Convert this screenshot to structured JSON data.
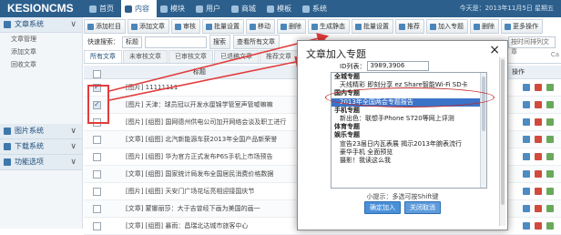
{
  "app": {
    "logo": "KESIONCMS",
    "header_right": "今天是：2013年11月5日 星期五"
  },
  "top_nav": [
    {
      "label": "首页",
      "icon": "home-icon",
      "active": false
    },
    {
      "label": "内容",
      "icon": "document-icon",
      "active": true
    },
    {
      "label": "模块",
      "icon": "grid-icon",
      "active": false
    },
    {
      "label": "用户",
      "icon": "user-icon",
      "active": false
    },
    {
      "label": "商城",
      "icon": "cart-icon",
      "active": false
    },
    {
      "label": "模板",
      "icon": "template-icon",
      "active": false
    },
    {
      "label": "系统",
      "icon": "gear-icon",
      "active": false
    }
  ],
  "sidebar": {
    "groups": [
      {
        "label": "文章系统",
        "icon": "article-icon",
        "items": [
          "文章管理",
          "添加文章",
          "回收文章"
        ]
      },
      {
        "label": "图片系统",
        "icon": "image-icon",
        "items": []
      },
      {
        "label": "下载系统",
        "icon": "download-icon",
        "items": []
      },
      {
        "label": "功能选项",
        "icon": "options-icon",
        "items": []
      }
    ]
  },
  "toolbar": {
    "buttons": [
      "添加栏目",
      "添加文章",
      "审核",
      "批量设置",
      "移动",
      "删除",
      "生成静态",
      "批量设置",
      "推荐",
      "加入专题",
      "删除",
      "更多操作"
    ]
  },
  "filter": {
    "label": "快速搜索：",
    "field": "标题",
    "button": "搜索",
    "advanced": "查看所有文章",
    "right_search": "按时间排列文章"
  },
  "subtabs": [
    "所有文章",
    "未审核文章",
    "已审核文章",
    "已退稿文章",
    "推荐文章",
    "图片文章",
    "滚动文章",
    "头条文章"
  ],
  "right_tab_label": "Ca",
  "table": {
    "header": {
      "title": "标题",
      "right": "操作"
    },
    "rows": [
      {
        "title": "[图片] 11111111",
        "checked": true
      },
      {
        "title": "[图片] 天津：球员冠以开发水厘锦学管室声管嘘嘛嘛",
        "checked": true
      },
      {
        "title": "[图片] [组图] 国网德州供电公司加开网络会谈及职工进行",
        "checked": false
      },
      {
        "title": "[文章] [组图] 北汽新能源车获2013年全国产品新荣誉",
        "checked": false
      },
      {
        "title": "[图片] [组图] 华为官方正式发布P6S手机上市场预告",
        "checked": false
      },
      {
        "title": "[文章] [组图] 国家统计局发布全国居民消费价格数据",
        "checked": false
      },
      {
        "title": "[图片] [组图] 天安门广场花坛亮相迎接国庆节",
        "checked": false
      },
      {
        "title": "[文章] 蒙娜丽莎：大于吉曾经下画为美国的画一",
        "checked": false
      },
      {
        "title": "[文章] [组图] 暴雨：昌瑞北达城市旅客中心",
        "checked": false
      }
    ]
  },
  "modal": {
    "title": "文章加入专题",
    "close": "×",
    "id_label": "ID列表：",
    "id_value": "3989,3906",
    "topics": [
      {
        "label": "全城专题",
        "kind": "group",
        "selected": false
      },
      {
        "label": "天线精彩 即刻分享 ez Share智能Wi-Fi SD卡",
        "kind": "child",
        "selected": false
      },
      {
        "label": "国内专题",
        "kind": "group",
        "selected": false
      },
      {
        "label": "2013年全国两会专题报告",
        "kind": "child",
        "selected": true
      },
      {
        "label": "手机专题",
        "kind": "group",
        "selected": false
      },
      {
        "label": "新出色：联想手Phone S720等网上评测",
        "kind": "child",
        "selected": false
      },
      {
        "label": "体育专题",
        "kind": "group",
        "selected": false
      },
      {
        "label": "娱乐专题",
        "kind": "group",
        "selected": false
      },
      {
        "label": "宣告23届日内瓦表展 揭示2013年腕表流行",
        "kind": "child",
        "selected": false
      },
      {
        "label": "豪华手机 全面预览",
        "kind": "child",
        "selected": false
      },
      {
        "label": "摄影！我读这么我",
        "kind": "child",
        "selected": false
      }
    ],
    "hint": "小提示：多选可按Shift键",
    "confirm": "确定加入",
    "cancel": "关闭取消"
  },
  "colors": {
    "header_bg": "#2c5f8c",
    "selected_item": "#3b73c9",
    "annotation_red": "#e23c3c",
    "button_blue": "#4a90d9"
  }
}
